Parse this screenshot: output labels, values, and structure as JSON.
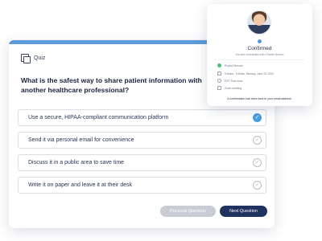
{
  "quiz": {
    "title": "Quiz",
    "question": "What is the safest way to share patient information with another healthcare professional?",
    "options": [
      {
        "label": "Use a secure, HIPAA-compliant communication platform",
        "selected": true
      },
      {
        "label": "Send it via personal email for convenience",
        "selected": false
      },
      {
        "label": "Discuss it in a public area to save time",
        "selected": false
      },
      {
        "label": "Write it on paper and leave it at their desk",
        "selected": false
      }
    ],
    "prev_label": "Previous Question",
    "next_label": "Next Question"
  },
  "confirmation": {
    "title": "Confirmed",
    "subtitle": "You are scheduled with Charlie Nelson",
    "details": [
      {
        "icon": "status-dot-icon",
        "text": "Project Director"
      },
      {
        "icon": "calendar-icon",
        "text": "9:00am - 9:30am, Monday, June 20, 2022"
      },
      {
        "icon": "globe-icon",
        "text": "EST Time zone"
      },
      {
        "icon": "video-icon",
        "text": "Zoom meeting"
      }
    ],
    "note": "A confirmation has been sent to your email address."
  },
  "colors": {
    "accent": "#5b9bd9",
    "selected": "#4a9ee0",
    "primary_button": "#1f3260",
    "disabled_button": "#c9ccd2",
    "status_green": "#4bc17a"
  }
}
